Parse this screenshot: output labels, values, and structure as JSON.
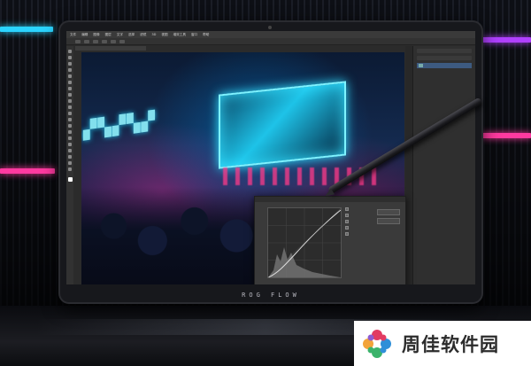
{
  "photo": {
    "device_brand": "ROG FLOW",
    "watermark_text": "周佳软件园",
    "watermark_logo_colors": [
      "#e23b62",
      "#3bb36b",
      "#2f8fd8",
      "#f2a33a"
    ]
  },
  "photoshop": {
    "menu_items": [
      "文件",
      "编辑",
      "图像",
      "图层",
      "文字",
      "选择",
      "滤镜",
      "3D",
      "视图",
      "增效工具",
      "窗口",
      "帮助"
    ],
    "document_tab": "",
    "layer_name": ""
  },
  "curves_dialog": {
    "title": "",
    "options": [
      "",
      "",
      "",
      "",
      ""
    ],
    "buttons": [
      "",
      ""
    ]
  },
  "colors": {
    "neon_cyan": "#33e0ff",
    "neon_pink": "#ff3a8a",
    "neon_purple": "#b040ff"
  }
}
